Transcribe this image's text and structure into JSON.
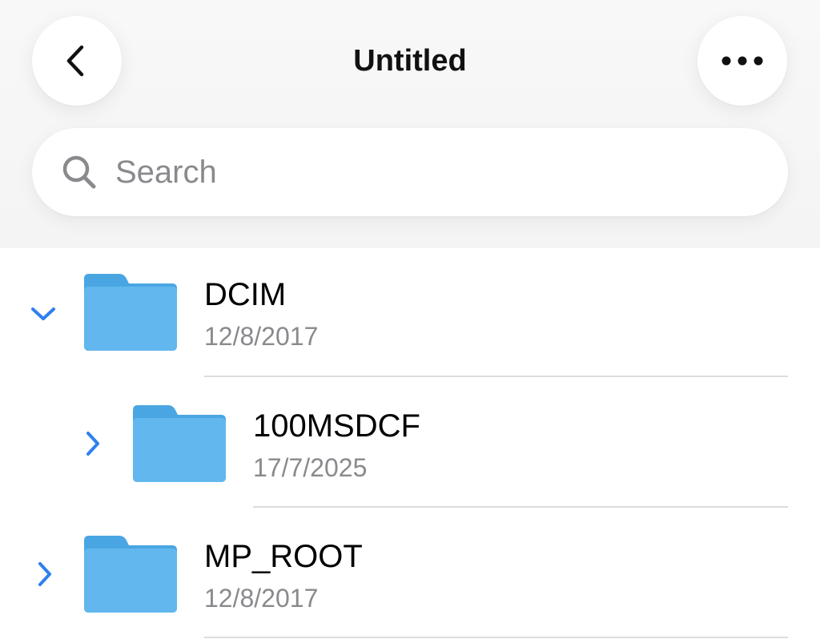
{
  "header": {
    "title": "Untitled",
    "back_icon": "chevron-left-icon",
    "more_icon": "ellipsis-icon"
  },
  "search": {
    "placeholder": "Search",
    "icon": "search-icon"
  },
  "colors": {
    "accent": "#2f80ed",
    "folder": "#5fb4ec",
    "secondary_text": "#8a8a8e"
  },
  "items": [
    {
      "name": "DCIM",
      "date": "12/8/2017",
      "expanded": true,
      "level": 0,
      "icon": "folder-icon"
    },
    {
      "name": "100MSDCF",
      "date": "17/7/2025",
      "expanded": false,
      "level": 1,
      "icon": "folder-icon"
    },
    {
      "name": "MP_ROOT",
      "date": "12/8/2017",
      "expanded": false,
      "level": 0,
      "icon": "folder-icon"
    }
  ]
}
